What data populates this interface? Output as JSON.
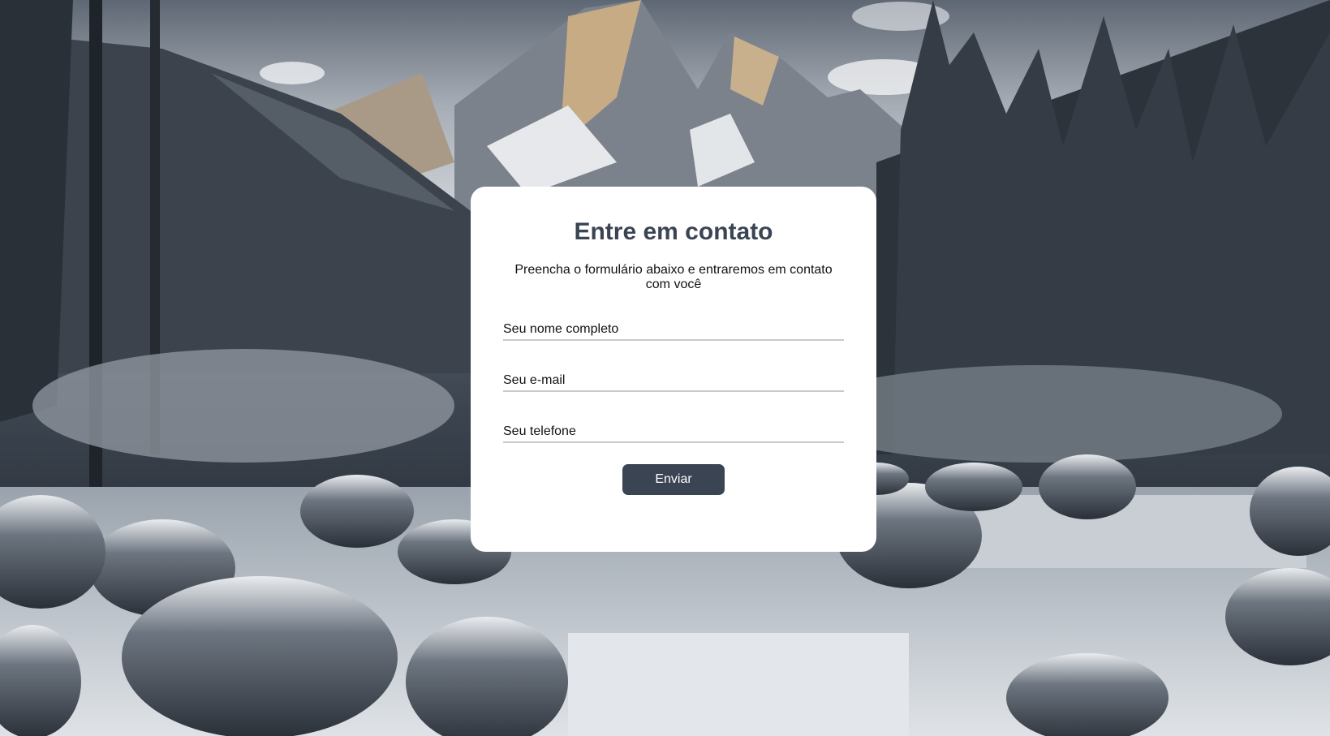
{
  "contact": {
    "title": "Entre em contato",
    "subtitle": "Preencha o formulário abaixo e entraremos em contato com você",
    "fields": {
      "name_placeholder": "Seu nome completo",
      "email_placeholder": "Seu e-mail",
      "phone_placeholder": "Seu telefone"
    },
    "submit_label": "Enviar"
  },
  "colors": {
    "accent": "#3a4453",
    "card_background": "#ffffff",
    "field_underline": "#c9c9c9"
  }
}
